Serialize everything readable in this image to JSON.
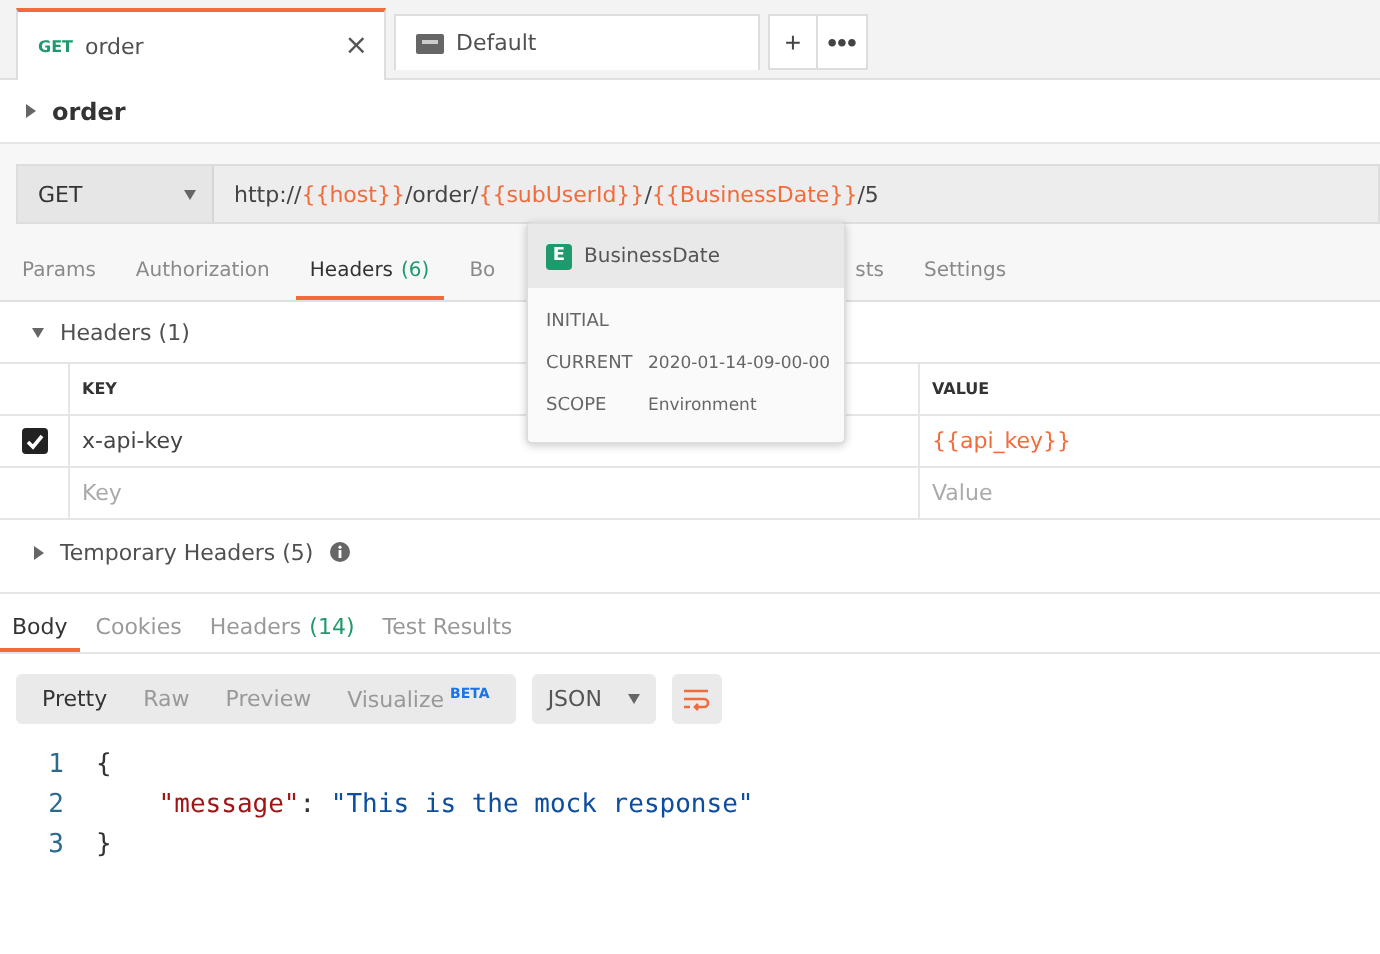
{
  "tabs": [
    {
      "method": "GET",
      "label": "order",
      "selected": true,
      "close": "×"
    },
    {
      "label": "Default",
      "selected": false
    }
  ],
  "tab_actions": [
    "+",
    "•••"
  ],
  "request_name": "order",
  "method": "GET",
  "url": [
    {
      "kind": "text",
      "text": "http://"
    },
    {
      "kind": "var",
      "text": "{{host}}"
    },
    {
      "kind": "text",
      "text": "/order/"
    },
    {
      "kind": "var",
      "text": "{{subUserId}}"
    },
    {
      "kind": "text",
      "text": "/"
    },
    {
      "kind": "var",
      "text": "{{BusinessDate}}"
    },
    {
      "kind": "text",
      "text": "/5"
    }
  ],
  "request_tabs": [
    {
      "label": "Params",
      "selected": false
    },
    {
      "label": "Authorization",
      "selected": false
    },
    {
      "label": "Headers",
      "count": "(6)",
      "selected": true
    },
    {
      "label": "Bo",
      "selected": false
    },
    {
      "label": "sts",
      "selected": false
    },
    {
      "label": "Settings",
      "selected": false
    }
  ],
  "headers_section": {
    "title": "Headers",
    "count": "(1)",
    "expanded": true
  },
  "table": {
    "columns": [
      "KEY",
      "VALUE"
    ],
    "rows": [
      {
        "checked": true,
        "key": "x-api-key",
        "value": "{{api_key}}"
      }
    ],
    "new_row": [
      {
        "placeholder": "Key"
      },
      {
        "placeholder": "Value"
      }
    ]
  },
  "temporary_headers": {
    "title": "Temporary Headers",
    "count": "(5)",
    "expanded": false
  },
  "popover": {
    "badge": "E",
    "title": "BusinessDate",
    "rows": [
      {
        "label": "INITIAL",
        "value": ""
      },
      {
        "label": "CURRENT",
        "value": "2020-01-14-09-00-00"
      },
      {
        "label": "SCOPE",
        "value": "Environment"
      }
    ]
  },
  "response_tabs": [
    {
      "label": "Body",
      "selected": true
    },
    {
      "label": "Cookies",
      "selected": false
    },
    {
      "label": "Headers",
      "count": "(14)",
      "selected": false
    },
    {
      "label": "Test Results",
      "selected": false
    }
  ],
  "view_modes": [
    {
      "label": "Pretty",
      "selected": true
    },
    {
      "label": "Raw",
      "selected": false
    },
    {
      "label": "Preview",
      "selected": false
    },
    {
      "label": "Visualize",
      "badge": "BETA",
      "selected": false
    }
  ],
  "format": "JSON",
  "code": [
    {
      "line": "1",
      "tokens": [
        {
          "kind": "punct",
          "text": "{"
        }
      ]
    },
    {
      "line": "2",
      "tokens": [
        {
          "kind": "key",
          "text": "    \"message\""
        },
        {
          "kind": "punct",
          "text": ": "
        },
        {
          "kind": "string",
          "text": "\"This is the mock response\""
        }
      ]
    },
    {
      "line": "3",
      "tokens": [
        {
          "kind": "punct",
          "text": "}"
        }
      ]
    }
  ]
}
